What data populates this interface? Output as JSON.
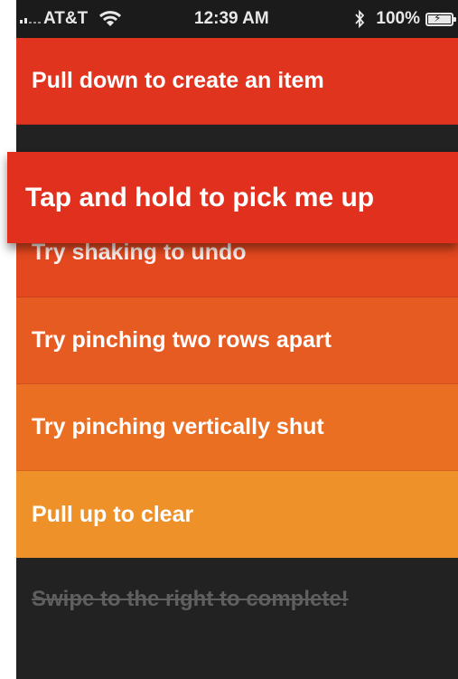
{
  "status_bar": {
    "carrier": "AT&T",
    "time": "12:39 AM",
    "battery": "100%",
    "battery_level": 1.0,
    "icons": [
      "signal-icon",
      "wifi-icon",
      "bluetooth-icon",
      "battery-icon"
    ]
  },
  "list": {
    "items": [
      {
        "label": "Pull down to create an item",
        "color": "#e1341f"
      },
      {
        "label": "Try shaking to undo",
        "color": "#e4481f"
      },
      {
        "label": "Try pinching two rows apart",
        "color": "#e65b22"
      },
      {
        "label": "Try pinching vertically shut",
        "color": "#ea6f23"
      },
      {
        "label": "Pull up to clear",
        "color": "#ee9128"
      }
    ],
    "dragged_item": {
      "label": "Tap and hold to pick me up",
      "color": "#e1311e"
    },
    "completed_item": {
      "label": "Swipe to the right to complete!",
      "color": "#5f5f5f"
    },
    "background_color": "#222222"
  }
}
